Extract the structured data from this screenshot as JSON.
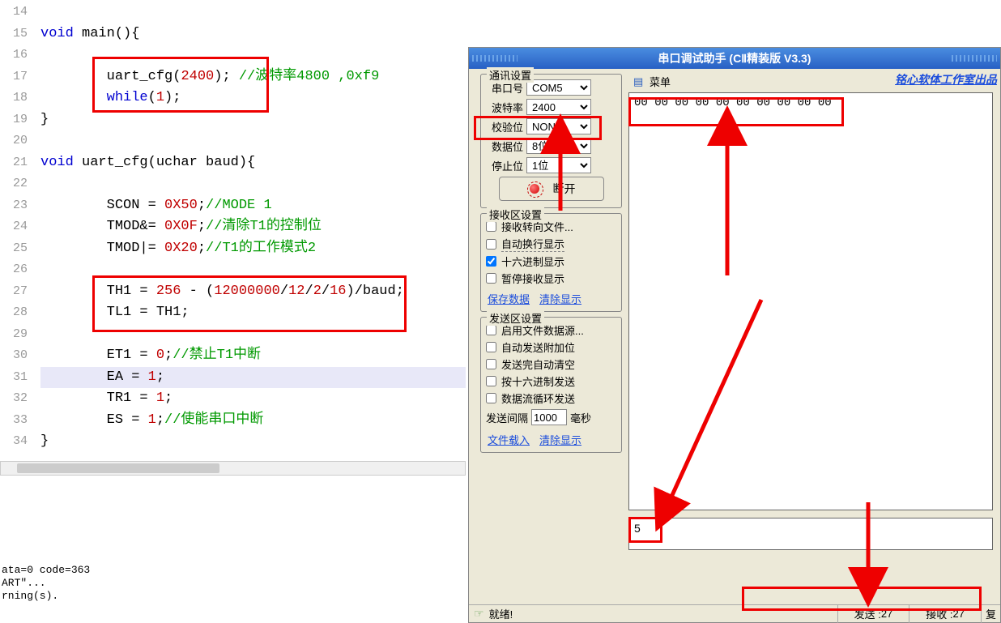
{
  "editor": {
    "lines": [
      {
        "n": 14,
        "html": ""
      },
      {
        "n": 15,
        "html": "<span class='tok-keyword'>void</span> main(){"
      },
      {
        "n": 16,
        "html": ""
      },
      {
        "n": 17,
        "html": "        uart_cfg(<span class='tok-number'>2400</span>); <span class='tok-comment'>//波特率4800 ,0xf9</span>"
      },
      {
        "n": 18,
        "html": "        <span class='tok-keyword'>while</span>(<span class='tok-number'>1</span>);"
      },
      {
        "n": 19,
        "html": "}"
      },
      {
        "n": 20,
        "html": ""
      },
      {
        "n": 21,
        "html": "<span class='tok-keyword'>void</span> uart_cfg(uchar baud){"
      },
      {
        "n": 22,
        "html": ""
      },
      {
        "n": 23,
        "html": "        SCON = <span class='tok-number'>0X50</span>;<span class='tok-comment'>//MODE 1</span>"
      },
      {
        "n": 24,
        "html": "        TMOD&= <span class='tok-number'>0X0F</span>;<span class='tok-comment'>//清除T1的控制位</span>"
      },
      {
        "n": 25,
        "html": "        TMOD|= <span class='tok-number'>0X20</span>;<span class='tok-comment'>//T1的工作模式2</span>"
      },
      {
        "n": 26,
        "html": ""
      },
      {
        "n": 27,
        "html": "        TH1 = <span class='tok-number'>256</span> - (<span class='tok-number'>12000000</span>/<span class='tok-number'>12</span>/<span class='tok-number'>2</span>/<span class='tok-number'>16</span>)/baud;"
      },
      {
        "n": 28,
        "html": "        TL1 = TH1;"
      },
      {
        "n": 29,
        "html": ""
      },
      {
        "n": 30,
        "html": "        ET1 = <span class='tok-number'>0</span>;<span class='tok-comment'>//禁止T1中断</span>"
      },
      {
        "n": 31,
        "html": "        EA = <span class='tok-number'>1</span>;",
        "hl": true
      },
      {
        "n": 32,
        "html": "        TR1 = <span class='tok-number'>1</span>;"
      },
      {
        "n": 33,
        "html": "        ES = <span class='tok-number'>1</span>;<span class='tok-comment'>//使能串口中断</span>"
      },
      {
        "n": 34,
        "html": "}"
      }
    ]
  },
  "build": {
    "l1": "ata=0 code=363",
    "l2": "ART\"...",
    "l3": "rning(s)."
  },
  "win": {
    "title": "串口调试助手 (CⅡ精装版 V3.3)",
    "brand": "铭心软体工作室出品"
  },
  "comm": {
    "legend": "通讯设置",
    "port_label": "串口号",
    "port_value": "COM5",
    "baud_label": "波特率",
    "baud_value": "2400",
    "parity_label": "校验位",
    "parity_value": "NONE",
    "databits_label": "数据位",
    "databits_value": "8位",
    "stopbits_label": "停止位",
    "stopbits_value": "1位",
    "disconnect": "断开"
  },
  "rx": {
    "legend": "接收区设置",
    "to_file": "接收转向文件...",
    "auto_wrap": "自动换行显示",
    "hex": "十六进制显示",
    "pause": "暂停接收显示",
    "save": "保存数据",
    "clear": "清除显示"
  },
  "tx": {
    "legend": "发送区设置",
    "file_src": "启用文件数据源...",
    "extra_bit": "自动发送附加位",
    "auto_clear": "发送完自动清空",
    "hex_send": "按十六进制发送",
    "loop_send": "数据流循环发送",
    "interval_label": "发送间隔",
    "interval_value": "1000",
    "interval_unit": "毫秒",
    "file_load": "文件载入",
    "clear": "清除显示"
  },
  "menu": {
    "label": "菜单"
  },
  "rx_data": "00 00 00 00 00 00 00 00 00 00",
  "tx_data": "5",
  "status": {
    "ready": "就绪!",
    "sent_label": "发送 :",
    "sent_value": "27",
    "recv_label": "接收 :",
    "recv_value": "27",
    "reset": "复"
  }
}
